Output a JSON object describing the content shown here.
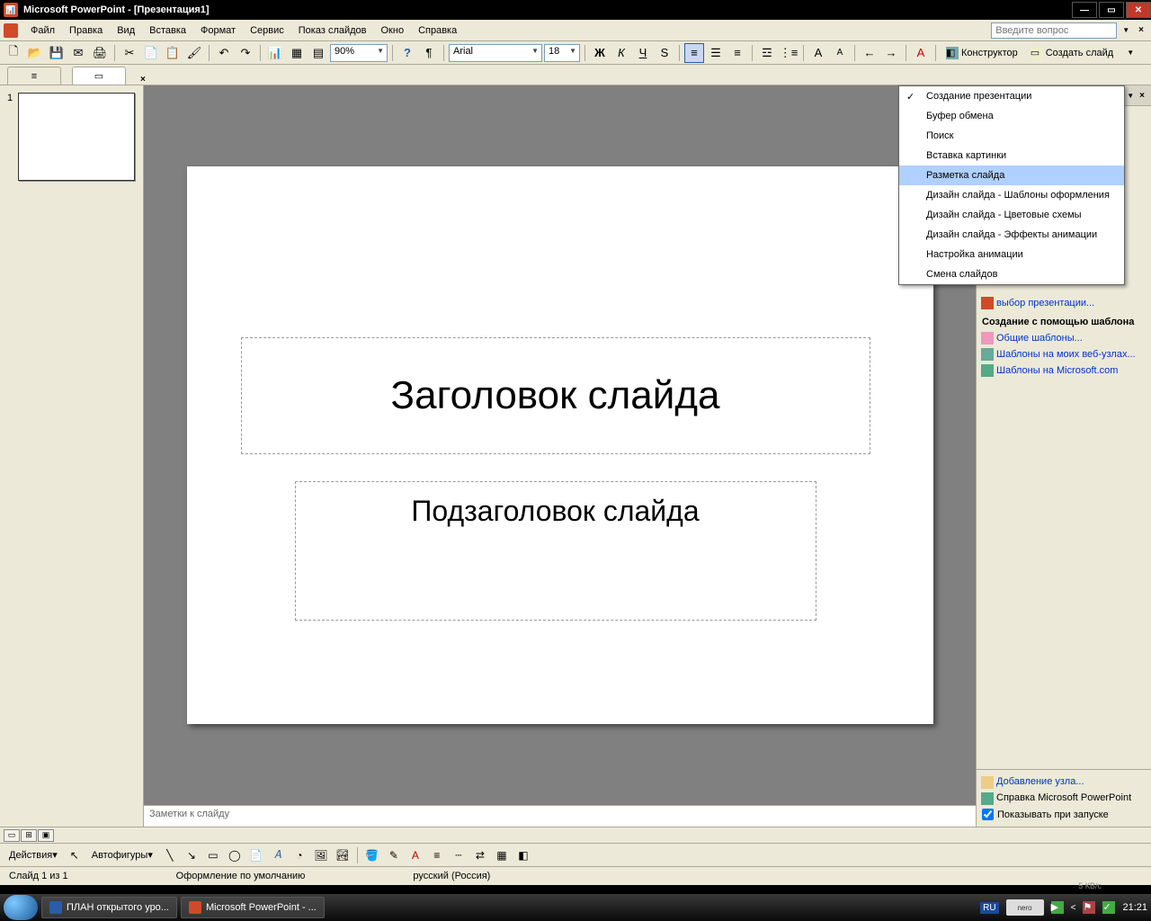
{
  "titlebar": {
    "app": "Microsoft PowerPoint",
    "doc": "[Презентация1]"
  },
  "menu": {
    "file": "Файл",
    "edit": "Правка",
    "view": "Вид",
    "insert": "Вставка",
    "format": "Формат",
    "tools": "Сервис",
    "slideshow": "Показ слайдов",
    "window": "Окно",
    "help": "Справка",
    "helpbox": "Введите вопрос"
  },
  "toolbar": {
    "zoom": "90%",
    "font": "Arial",
    "size": "18",
    "constructor": "Конструктор",
    "newslide": "Создать слайд"
  },
  "thumbnail": {
    "num": "1"
  },
  "slide": {
    "title": "Заголовок слайда",
    "subtitle": "Подзаголовок слайда"
  },
  "notes": {
    "placeholder": "Заметки к слайду"
  },
  "taskpane": {
    "title": "Создание презентации",
    "hidden_item_label": "выбор презентации...",
    "template_heading": "Создание с помощью шаблона",
    "t1": "Общие шаблоны...",
    "t2": "Шаблоны на моих веб-узлах...",
    "t3": "Шаблоны на Microsoft.com",
    "add_node": "Добавление узла...",
    "pp_help": "Справка Microsoft PowerPoint",
    "show_startup": "Показывать при запуске"
  },
  "dropdown": {
    "i0": "Создание презентации",
    "i1": "Буфер обмена",
    "i2": "Поиск",
    "i3": "Вставка картинки",
    "i4": "Разметка слайда",
    "i5": "Дизайн слайда - Шаблоны оформления",
    "i6": "Дизайн слайда - Цветовые схемы",
    "i7": "Дизайн слайда - Эффекты анимации",
    "i8": "Настройка анимации",
    "i9": "Смена слайдов"
  },
  "drawbar": {
    "actions": "Действия",
    "autoshapes": "Автофигуры"
  },
  "status": {
    "slide": "Слайд 1 из 1",
    "design": "Оформление по умолчанию",
    "lang": "русский (Россия)"
  },
  "wtask": {
    "t1": "ПЛАН открытого уро...",
    "t2": "Microsoft PowerPoint - ...",
    "lang": "RU",
    "nero": "nero",
    "speed": "5 КВ/с",
    "clock": "21:21"
  }
}
